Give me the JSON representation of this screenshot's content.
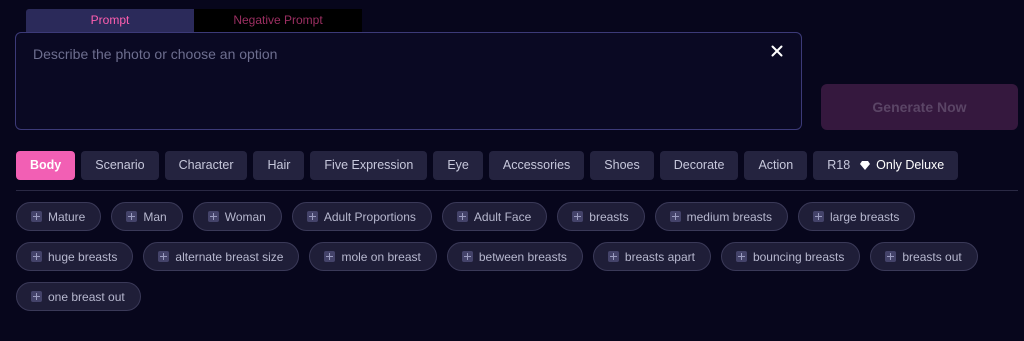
{
  "prompt_tabs": {
    "prompt": "Prompt",
    "negative": "Negative Prompt"
  },
  "prompt_box": {
    "placeholder": "Describe the photo or choose an option",
    "value": ""
  },
  "generate_label": "Generate Now",
  "categories": [
    {
      "label": "Body",
      "active": true
    },
    {
      "label": "Scenario"
    },
    {
      "label": "Character"
    },
    {
      "label": "Hair"
    },
    {
      "label": "Five Expression"
    },
    {
      "label": "Eye"
    },
    {
      "label": "Accessories"
    },
    {
      "label": "Shoes"
    },
    {
      "label": "Decorate"
    },
    {
      "label": "Action"
    },
    {
      "label": "R18",
      "extra": "Only Deluxe",
      "icon": "diamond-icon"
    }
  ],
  "tags": [
    "Mature",
    "Man",
    "Woman",
    "Adult Proportions",
    "Adult Face",
    "breasts",
    "medium breasts",
    "large breasts",
    "huge breasts",
    "alternate breast size",
    "mole on breast",
    "between breasts",
    "breasts apart",
    "bouncing breasts",
    "breasts out",
    "one breast out"
  ],
  "colors": {
    "background": "#07061c",
    "accent_pink": "#f25fb4",
    "generate_disabled": "#35183e"
  }
}
